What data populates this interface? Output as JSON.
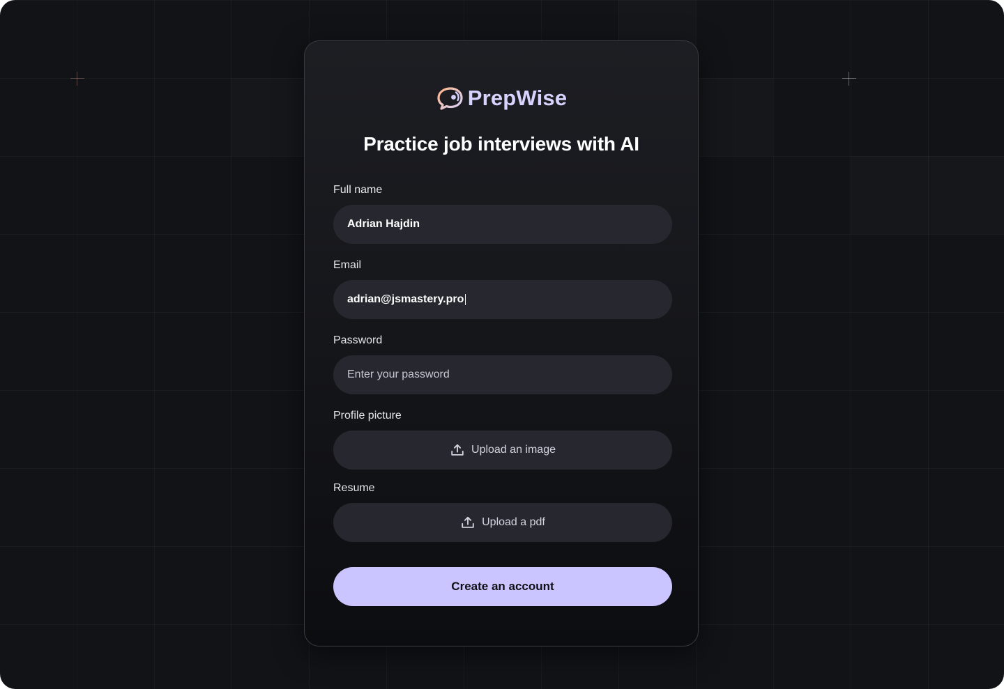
{
  "brand": {
    "name": "PrepWise",
    "logo_icon": "chat-bubble-logo-icon"
  },
  "headline": "Practice job interviews with AI",
  "form": {
    "full_name": {
      "label": "Full name",
      "value": "Adrian Hajdin"
    },
    "email": {
      "label": "Email",
      "value": "adrian@jsmastery.pro"
    },
    "password": {
      "label": "Password",
      "placeholder": "Enter your password"
    },
    "profile_picture": {
      "label": "Profile picture",
      "button_label": "Upload an image",
      "icon": "upload-icon"
    },
    "resume": {
      "label": "Resume",
      "button_label": "Upload a pdf",
      "icon": "upload-icon"
    },
    "submit_label": "Create an account"
  },
  "colors": {
    "background": "#121317",
    "card": "#1a1b20",
    "input": "#27282f",
    "accent": "#cac5fe",
    "brand_text": "#d6d4ff",
    "logo_gradient_start": "#ffb48a",
    "logo_gradient_end": "#d6d4ff"
  }
}
